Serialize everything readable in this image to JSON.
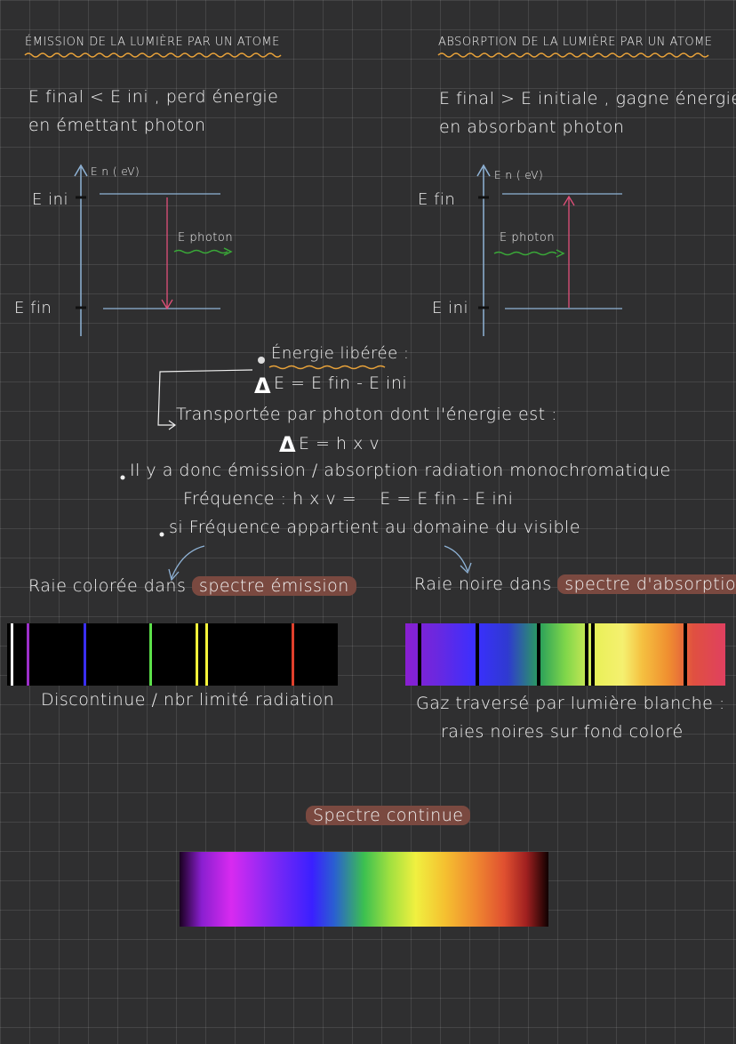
{
  "emission": {
    "title": "ÉMISSION DE LA LUMIÈRE PAR UN ATOME",
    "line1": "E final < E ini , perd énergie",
    "line2": "en émettant photon",
    "axis_label": "E n ( eV)",
    "level_top": "E ini",
    "level_bottom": "E fin",
    "photon_label": "E photon"
  },
  "absorption": {
    "title": "ABSORPTION DE LA LUMIÈRE PAR UN ATOME",
    "line1": "E final > E initiale , gagne énergie",
    "line2": "en absorbant photon",
    "axis_label": "E n ( eV)",
    "level_top": "E fin",
    "level_bottom": "E ini",
    "photon_label": "E photon"
  },
  "middle": {
    "energy_released": "Énergie libérée :",
    "delta_symbol": "Δ",
    "formula1": "E = E fin - E ini",
    "transported": "Transportée par photon dont l'énergie est :",
    "formula2": "E = h x v",
    "monochromatic": "Il y a donc émission / absorption radiation monochromatique",
    "frequency": "Fréquence : h x v =    E = E fin - E ini",
    "visible": "si Fréquence appartient au domaine du visible"
  },
  "emission_spectrum": {
    "label_prefix": "Raie colorée dans",
    "label_highlight": "spectre émission",
    "caption": "Discontinue / nbr limité radiation",
    "lines": [
      {
        "pos": 0.01,
        "color": "#ffffff"
      },
      {
        "pos": 0.06,
        "color": "#9b2fc9"
      },
      {
        "pos": 0.23,
        "color": "#3a2fff"
      },
      {
        "pos": 0.43,
        "color": "#5ce04a"
      },
      {
        "pos": 0.57,
        "color": "#f5f53a"
      },
      {
        "pos": 0.6,
        "color": "#f5f53a"
      },
      {
        "pos": 0.86,
        "color": "#e0402c"
      }
    ]
  },
  "absorption_spectrum": {
    "label_prefix": "Raie noire dans",
    "label_highlight": "spectre d'absorption",
    "caption1": "Gaz traversé par lumière blanche :",
    "caption2": "raies noires sur fond coloré",
    "dark_lines": [
      0.04,
      0.22,
      0.41,
      0.56,
      0.58,
      0.87
    ]
  },
  "continuous": {
    "label": "Spectre continue"
  },
  "colors": {
    "underline": "#e8a23a",
    "green_underline": "#3aa838",
    "highlight": "#7a4940",
    "axis": "#8fb3d6",
    "emission_arrow": "#e0507a",
    "absorption_arrow": "#e0507a"
  }
}
